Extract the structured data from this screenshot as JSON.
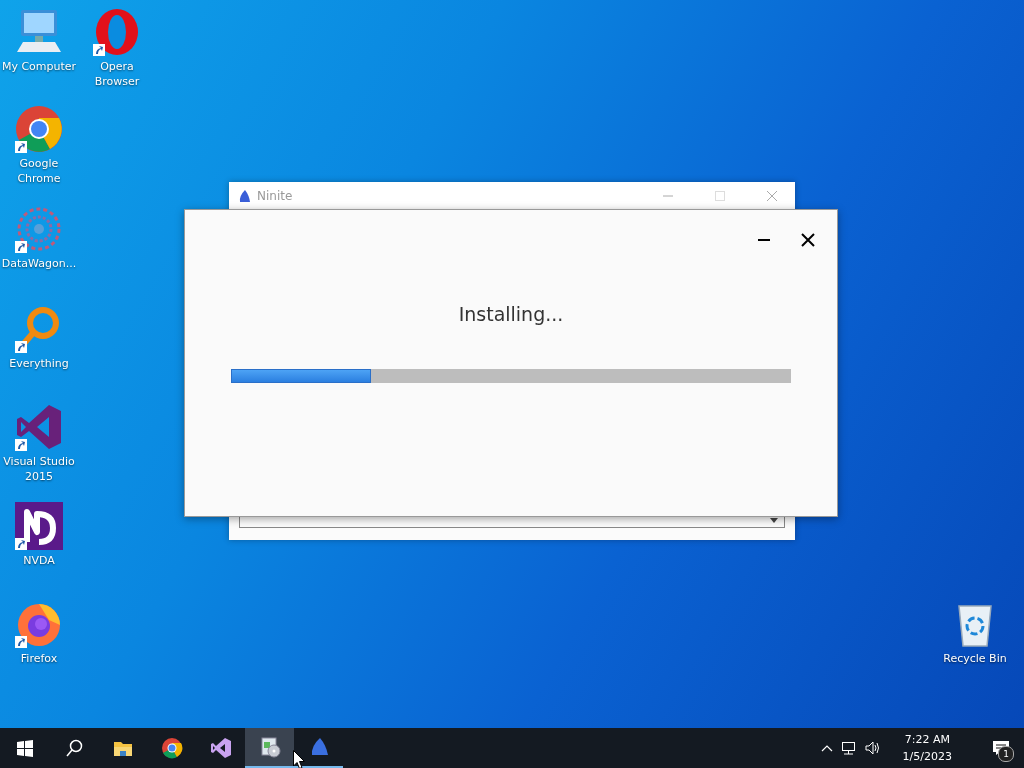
{
  "desktop_icons": [
    {
      "label": "My Computer",
      "kind": "computer",
      "shortcut": false
    },
    {
      "label": "Opera Browser",
      "kind": "opera",
      "shortcut": true
    },
    {
      "label": "Google Chrome",
      "kind": "chrome",
      "shortcut": true
    },
    {
      "label": "DataWagon...",
      "kind": "datawagon",
      "shortcut": true
    },
    {
      "label": "Everything",
      "kind": "everything",
      "shortcut": true
    },
    {
      "label": "Visual Studio 2015",
      "kind": "visualstudio",
      "shortcut": true
    },
    {
      "label": "NVDA",
      "kind": "nvda",
      "shortcut": true
    },
    {
      "label": "Firefox",
      "kind": "firefox",
      "shortcut": true
    },
    {
      "label": "Recycle Bin",
      "kind": "recyclebin",
      "shortcut": false
    }
  ],
  "background_window": {
    "title": "Ninite"
  },
  "dialog": {
    "status": "Installing...",
    "progress": {
      "level": 0.25
    }
  },
  "taskbar": {
    "items": [
      {
        "kind": "start",
        "running": false,
        "selected": false
      },
      {
        "kind": "search",
        "running": false,
        "selected": false
      },
      {
        "kind": "explorer",
        "running": false,
        "selected": false
      },
      {
        "kind": "chrome",
        "running": false,
        "selected": false
      },
      {
        "kind": "visualstudio",
        "running": false,
        "selected": false
      },
      {
        "kind": "installer",
        "running": true,
        "selected": true
      },
      {
        "kind": "ninite",
        "running": true,
        "selected": false
      }
    ],
    "tray": {
      "time": "7:22 AM",
      "date": "1/5/2023",
      "notifications": "1"
    }
  }
}
